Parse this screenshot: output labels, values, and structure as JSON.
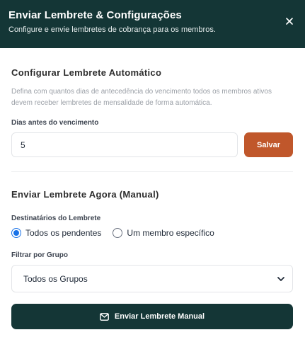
{
  "header": {
    "title": "Enviar Lembrete & Configurações",
    "subtitle": "Configure e envie lembretes de cobrança para os membros."
  },
  "auto_section": {
    "title": "Configurar Lembrete Automático",
    "description": "Defina com quantos dias de antecedência do vencimento todos os membros ativos devem receber lembretes de mensalidade de forma automática.",
    "days_label": "Dias antes do vencimento",
    "days_value": "5",
    "save_label": "Salvar"
  },
  "manual_section": {
    "title": "Enviar Lembrete Agora (Manual)",
    "recipients_label": "Destinatários do Lembrete",
    "recipients_options": [
      {
        "label": "Todos os pendentes",
        "selected": true
      },
      {
        "label": "Um membro específico",
        "selected": false
      }
    ],
    "group_label": "Filtrar por Grupo",
    "group_value": "Todos os Grupos",
    "send_label": "Enviar Lembrete Manual"
  },
  "colors": {
    "header_bg": "#143636",
    "save_button": "#c0572b",
    "send_button": "#143636",
    "radio_accent": "#1a73e8"
  },
  "icons": {
    "close": "close-icon",
    "mail": "mail-icon",
    "chevron": "chevron-down-icon"
  }
}
